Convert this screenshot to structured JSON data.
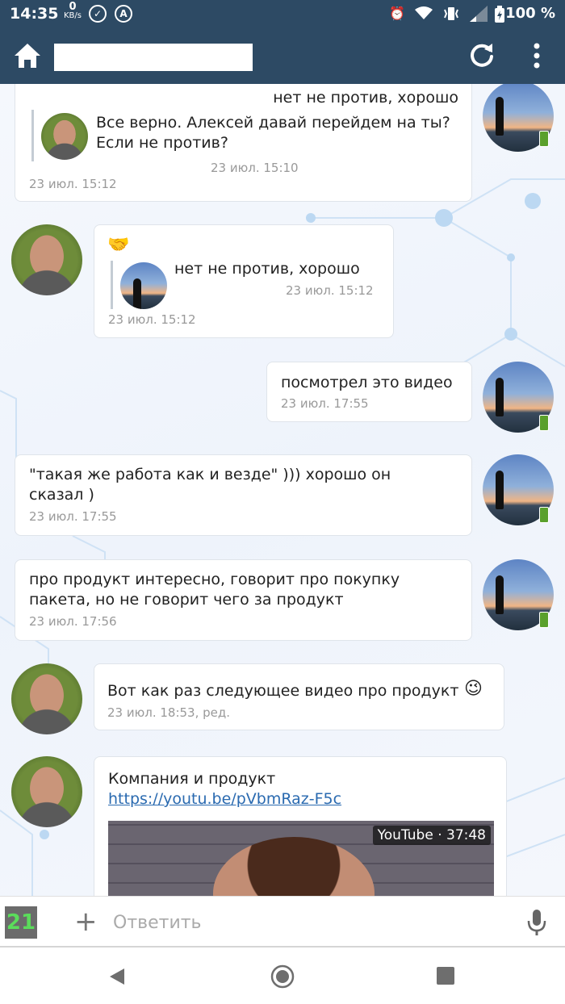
{
  "status_bar": {
    "time": "14:35",
    "net_value": "0",
    "net_unit": "KB/s",
    "check_icon": "check-circle-icon",
    "a_label": "A",
    "battery": "100 %"
  },
  "app_bar": {
    "home_icon": "home-icon",
    "refresh_icon": "refresh-icon",
    "more_icon": "more-vert-icon"
  },
  "messages": [
    {
      "author": "me",
      "text": "нет не против, хорошо",
      "quote": {
        "text": "Все верно. Алексей давай перейдем на ты?\nЕсли не против?",
        "time": "23 июл. 15:10"
      },
      "time": "23 июл. 15:12"
    },
    {
      "author": "other",
      "emoji": "🤝",
      "quote": {
        "text": "нет не против, хорошо",
        "time": "23 июл. 15:12"
      },
      "time": "23 июл. 15:12"
    },
    {
      "author": "me",
      "text": "посмотрел это видео",
      "time": "23 июл. 17:55"
    },
    {
      "author": "me",
      "text": "\"такая же работа как и везде\" ))) хорошо он\nсказал )",
      "time": "23 июл. 17:55"
    },
    {
      "author": "me",
      "text": "про продукт интересно, говорит про покупку\nпакета, но не говорит чего за продукт",
      "time": "23 июл. 17:56"
    },
    {
      "author": "other",
      "text": "Вот как раз следующее видео про продукт",
      "emoji": "😉",
      "time": "23 июл. 18:53, ред."
    },
    {
      "author": "other",
      "text": "Компания и продукт",
      "link": "https://youtu.be/pVbmRaz-F5c",
      "video_badge": "YouTube · 37:48"
    }
  ],
  "input_bar": {
    "counter": "21",
    "plus": "+",
    "placeholder": "Ответить"
  },
  "colors": {
    "app_bar": "#2d4a64",
    "link": "#2a6ab0",
    "counter_text": "#5bdc5b",
    "phone_badge": "#5aa02c"
  }
}
